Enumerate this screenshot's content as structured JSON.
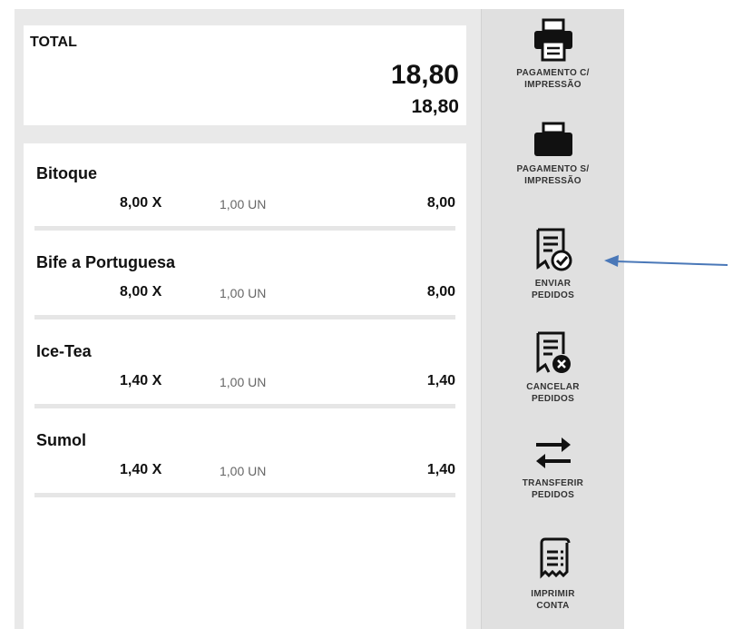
{
  "total": {
    "label": "TOTAL",
    "amount": "18,80",
    "amount_secondary": "18,80"
  },
  "items": [
    {
      "name": "Bitoque",
      "price": "8,00 X",
      "qty": "1,00 UN",
      "total": "8,00"
    },
    {
      "name": "Bife a Portuguesa",
      "price": "8,00 X",
      "qty": "1,00 UN",
      "total": "8,00"
    },
    {
      "name": "Ice-Tea",
      "price": "1,40 X",
      "qty": "1,00 UN",
      "total": "1,40"
    },
    {
      "name": "Sumol",
      "price": "1,40 X",
      "qty": "1,00 UN",
      "total": "1,40"
    }
  ],
  "actions": [
    {
      "label_line1": "PAGAMENTO C/",
      "label_line2": "IMPRESSÃO",
      "icon": "printer-icon"
    },
    {
      "label_line1": "PAGAMENTO S/",
      "label_line2": "IMPRESSÃO",
      "icon": "printer-icon"
    },
    {
      "label_line1": "ENVIAR",
      "label_line2": "PEDIDOS",
      "icon": "document-check-icon"
    },
    {
      "label_line1": "CANCELAR",
      "label_line2": "PEDIDOS",
      "icon": "document-cancel-icon"
    },
    {
      "label_line1": "TRANSFERIR",
      "label_line2": "PEDIDOS",
      "icon": "transfer-arrows-icon"
    },
    {
      "label_line1": "IMPRIMIR",
      "label_line2": "CONTA",
      "icon": "receipt-icon"
    }
  ],
  "colors": {
    "panel_bg": "#e9e9e9",
    "sidebar_bg": "#e0e0e0",
    "text": "#111111",
    "annotation_arrow": "#4a78b8"
  }
}
